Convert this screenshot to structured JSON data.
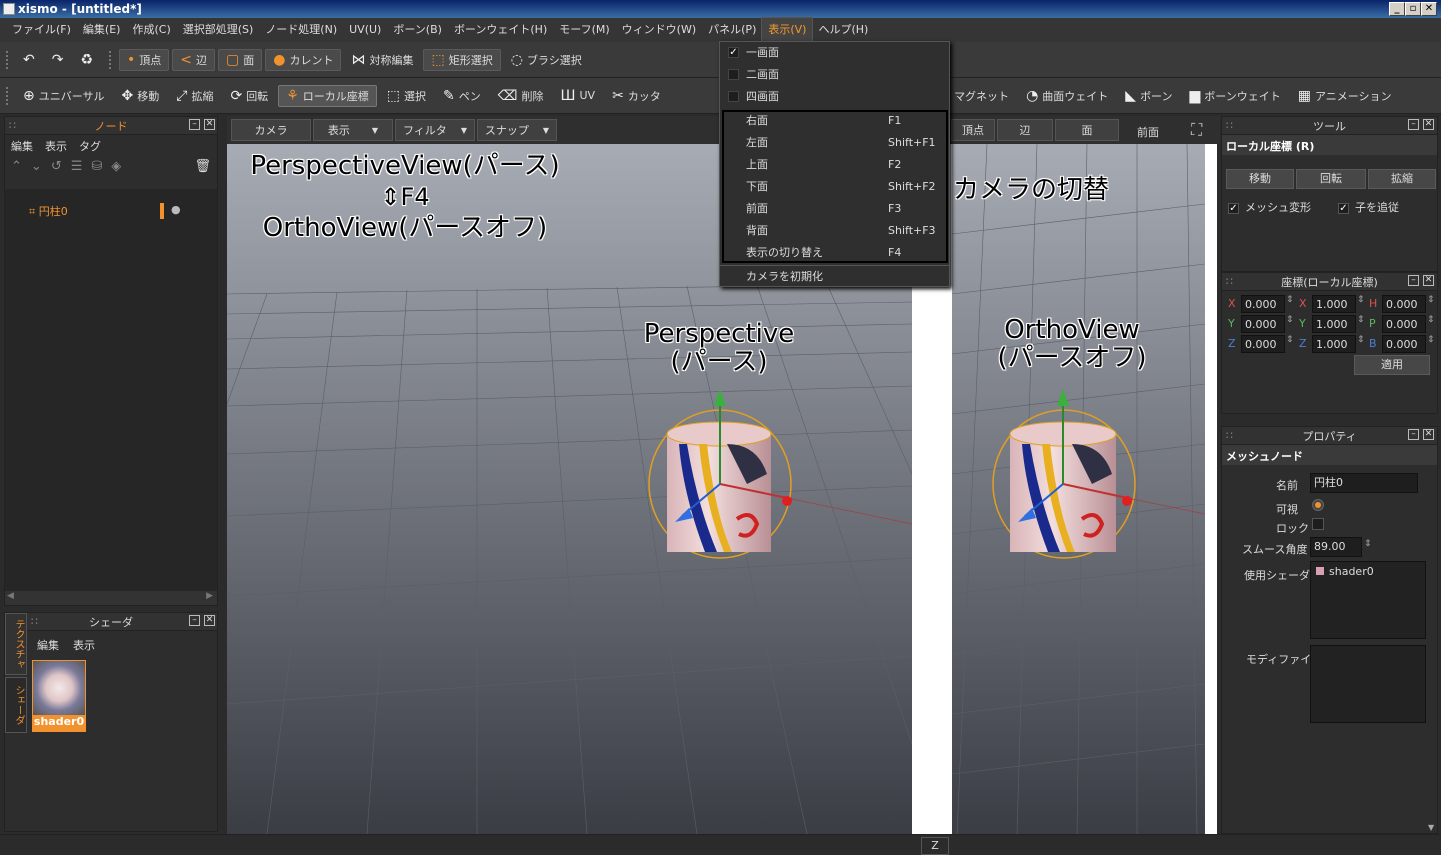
{
  "window": {
    "title": "xismo - [untitled*]",
    "min": "_",
    "max": "▫",
    "close": "✕"
  },
  "menu": [
    "ファイル(F)",
    "編集(E)",
    "作成(C)",
    "選択部処理(S)",
    "ノード処理(N)",
    "UV(U)",
    "ボーン(B)",
    "ボーンウェイト(H)",
    "モーフ(M)",
    "ウィンドウ(W)",
    "パネル(P)",
    "表示(V)",
    "ヘルプ(H)"
  ],
  "toolbar1": {
    "undo": "↶",
    "redo": "↷",
    "recycle": "♻",
    "vertex": "頂点",
    "edge": "辺",
    "face": "面",
    "current": "カレント",
    "symmetry": "対称編集",
    "rect_select": "矩形選択",
    "brush_select": "ブラシ選択"
  },
  "toolbar2": {
    "universal": "ユニバーサル",
    "move": "移動",
    "scale": "拡縮",
    "rotate": "回転",
    "local": "ローカル座標",
    "select": "選択",
    "pen": "ペン",
    "delete": "削除",
    "uv": "UV",
    "cutter": "カッタ",
    "magnet": "マグネット",
    "curve_weight": "曲面ウェイト",
    "bone": "ボーン",
    "bone_weight": "ボーンウェイト",
    "animation": "アニメーション"
  },
  "node_panel": {
    "title": "ノード",
    "menus": [
      "編集",
      "表示",
      "タグ"
    ],
    "item": "円柱0"
  },
  "shader_panel": {
    "title": "シェーダ",
    "menus": [
      "編集",
      "表示"
    ],
    "shader": "shader0",
    "tabs": [
      "テクスチャ",
      "シェーダ"
    ]
  },
  "viewport_header": {
    "camera": "カメラ",
    "display": "表示",
    "filter": "フィルタ",
    "snap": "スナップ",
    "vertex": "頂点",
    "edge": "辺",
    "face": "面",
    "front": "前面"
  },
  "annotations": {
    "line1": "PerspectiveView(パース)",
    "line2": "⇕F4",
    "line3": "OrthoView(パースオフ)",
    "camera_switch": "カメラの切替",
    "persp1": "Perspective",
    "persp2": "(パース)",
    "ortho1": "OrthoView",
    "ortho2": "(パースオフ)"
  },
  "dropdown": {
    "checks": [
      {
        "label": "一画面",
        "checked": true
      },
      {
        "label": "二画面",
        "checked": false
      },
      {
        "label": "四画面",
        "checked": false
      }
    ],
    "views": [
      {
        "label": "右面",
        "shortcut": "F1"
      },
      {
        "label": "左面",
        "shortcut": "Shift+F1"
      },
      {
        "label": "上面",
        "shortcut": "F2"
      },
      {
        "label": "下面",
        "shortcut": "Shift+F2"
      },
      {
        "label": "前面",
        "shortcut": "F3"
      },
      {
        "label": "背面",
        "shortcut": "Shift+F3"
      },
      {
        "label": "表示の切り替え",
        "shortcut": "F4"
      }
    ],
    "reset": "カメラを初期化"
  },
  "tool_panel": {
    "title": "ツール",
    "mode": "ローカル座標 (R)",
    "move": "移動",
    "rotate": "回転",
    "scale": "拡縮",
    "mesh_deform": "メッシュ変形",
    "follow_child": "子を追従"
  },
  "coord_panel": {
    "title": "座標(ローカル座標)",
    "pos": {
      "x": "0.000",
      "y": "0.000",
      "z": "0.000"
    },
    "scale": {
      "x": "1.000",
      "y": "1.000",
      "z": "1.000"
    },
    "hpb": {
      "h": "0.000",
      "p": "0.000",
      "b": "0.000"
    },
    "apply": "適用"
  },
  "prop_panel": {
    "title": "プロパティ",
    "section": "メッシュノード",
    "name_label": "名前",
    "name_value": "円柱0",
    "visible_label": "可視",
    "lock_label": "ロック",
    "smooth_label": "スムース角度",
    "smooth_value": "89.00",
    "shader_label": "使用シェーダ",
    "shader_value": "shader0",
    "modifier_label": "モディファイア"
  },
  "status": {
    "z": "Z"
  },
  "colors": {
    "accent": "#f2922e",
    "x": "#d9534f",
    "y": "#5cb85c",
    "z": "#4a7fd6"
  }
}
